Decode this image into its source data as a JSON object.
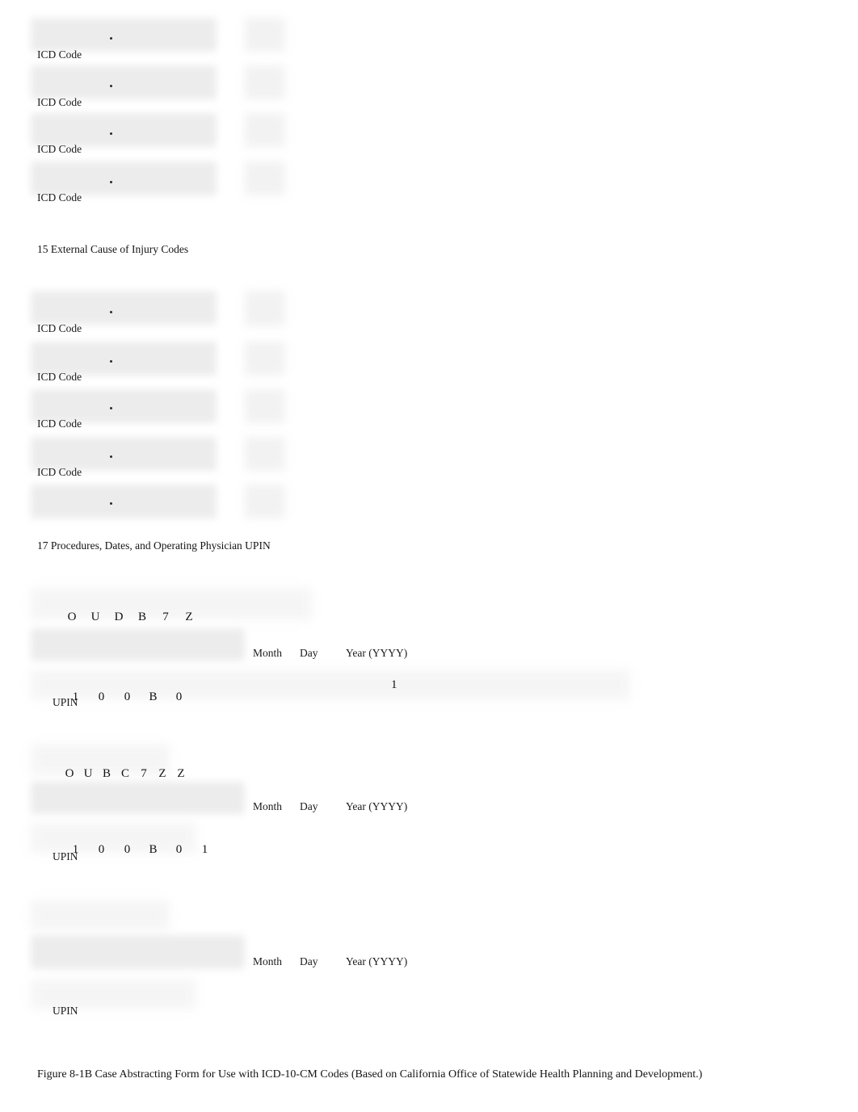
{
  "document": {
    "caption": "Figure 8-1B  Case Abstracting Form for Use with ICD-10-CM Codes (Based on California Office of Statewide Health Planning and Development.)"
  },
  "sections": {
    "diagnosis_codes": {
      "rows": [
        {
          "label": "ICD Code"
        },
        {
          "label": "ICD Code"
        },
        {
          "label": "ICD Code"
        },
        {
          "label": "ICD Code"
        }
      ]
    },
    "external_cause": {
      "heading": "15 External Cause of Injury Codes",
      "rows": [
        {
          "label": "ICD Code"
        },
        {
          "label": "ICD Code"
        },
        {
          "label": "ICD Code"
        },
        {
          "label": "ICD Code"
        },
        {
          "label": ""
        }
      ]
    },
    "procedures": {
      "heading": "17 Procedures, Dates, and Operating Physician UPIN",
      "date_labels": {
        "month": "Month",
        "day": "Day",
        "year": "Year (YYYY)"
      },
      "upin_label": "UPIN",
      "entries": [
        {
          "procedure_code": [
            "O",
            "U",
            "D",
            "B",
            "7",
            "Z"
          ],
          "upin": [
            "1",
            "0",
            "0",
            "B",
            "0"
          ],
          "trailing_value": "1"
        },
        {
          "procedure_code": [
            "O",
            "U",
            "B",
            "C",
            "7",
            "Z",
            "Z"
          ],
          "upin": [
            "1",
            "0",
            "0",
            "B",
            "0",
            "1"
          ],
          "trailing_value": ""
        },
        {
          "procedure_code": [],
          "upin": [],
          "trailing_value": ""
        }
      ]
    }
  },
  "colors": {
    "page_background": "#ffffff",
    "text": "#1a1a1a",
    "redaction_fill": "#ebebeb"
  }
}
